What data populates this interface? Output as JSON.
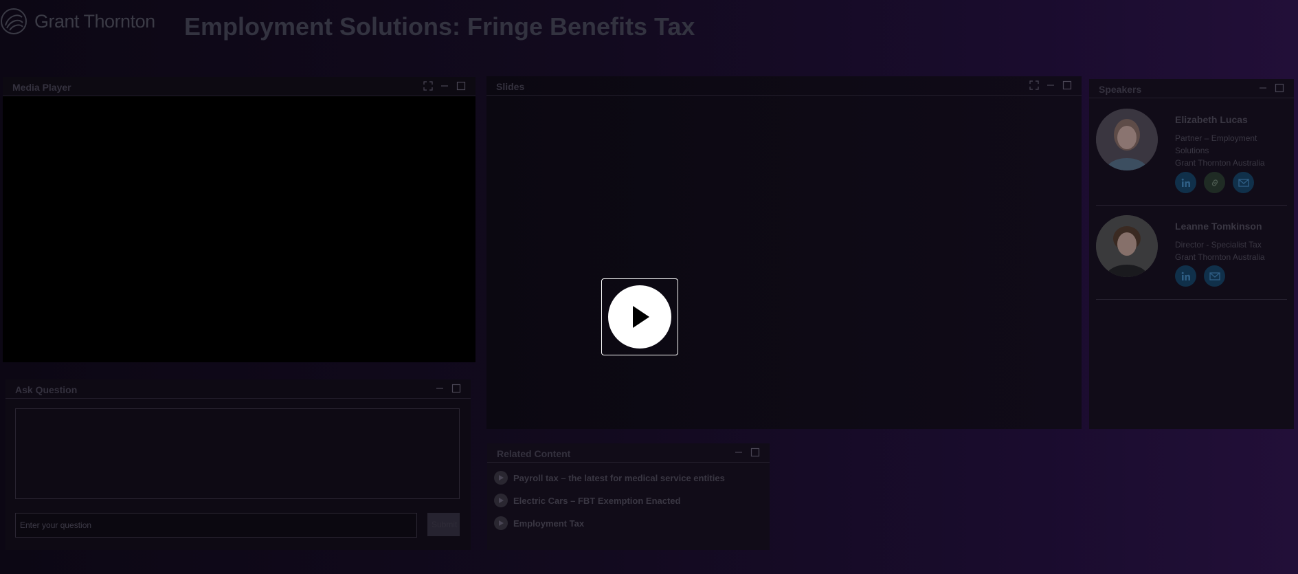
{
  "header": {
    "brand": "Grant Thornton",
    "title": "Employment Solutions: Fringe Benefits Tax"
  },
  "media_player": {
    "title": "Media Player"
  },
  "slides": {
    "title": "Slides"
  },
  "speakers": {
    "title": "Speakers",
    "items": [
      {
        "name": "Elizabeth Lucas",
        "role": "Partner – Employment Solutions",
        "company": "Grant Thornton Australia",
        "socials": [
          "linkedin-icon",
          "link-icon",
          "email-icon"
        ]
      },
      {
        "name": "Leanne Tomkinson",
        "role": "Director - Specialist Tax",
        "company": "Grant Thornton Australia",
        "socials": [
          "linkedin-icon",
          "email-icon"
        ]
      }
    ]
  },
  "ask_question": {
    "title": "Ask Question",
    "placeholder": "Enter your question",
    "submit_label": "Submit"
  },
  "related_content": {
    "title": "Related Content",
    "items": [
      "Payroll tax – the latest for medical service entities",
      "Electric Cars – FBT Exemption Enacted",
      "Employment Tax"
    ]
  },
  "colors": {
    "background_start": "#0c0714",
    "background_end": "#220f38",
    "linkedin": "#10304a"
  }
}
